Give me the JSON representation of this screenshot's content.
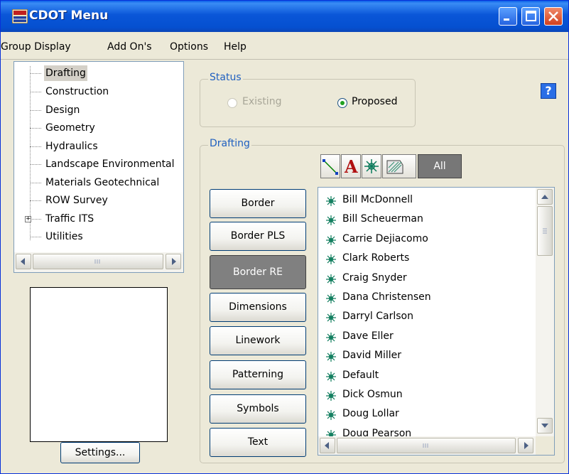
{
  "window": {
    "title": "CDOT Menu",
    "icon": "cdot-app-icon"
  },
  "menubar": [
    "Group Display",
    "Add On's",
    "Options",
    "Help"
  ],
  "tree": {
    "items": [
      "Drafting",
      "Construction",
      "Design",
      "Geometry",
      "Hydraulics",
      "Landscape Environmental",
      "Materials Geotechnical",
      "ROW Survey",
      "Traffic ITS",
      "Utilities"
    ],
    "selected": "Drafting",
    "expandable": "Traffic ITS",
    "expander_glyph": "+"
  },
  "settings_label": "Settings...",
  "status": {
    "title": "Status",
    "existing_label": "Existing",
    "proposed_label": "Proposed",
    "selected": "Proposed"
  },
  "help_label": "?",
  "drafting": {
    "title": "Drafting",
    "filters": {
      "line_icon": "line-tool-icon",
      "text_glyph": "A",
      "cell_icon": "cell-icon",
      "pattern_icon": "pattern-icon",
      "all_label": "All"
    },
    "categories": [
      "Border",
      "Border PLS",
      "Border RE",
      "Dimensions",
      "Linework",
      "Patterning",
      "Symbols",
      "Text"
    ],
    "active_category": "Border RE",
    "list": [
      "Bill McDonnell",
      "Bill Scheuerman",
      "Carrie Dejiacomo",
      "Clark Roberts",
      "Craig Snyder",
      "Dana Christensen",
      "Darryl Carlson",
      "Dave Eller",
      "David Miller",
      "Default",
      "Dick Osmun",
      "Doug Lollar",
      "Doug Pearson"
    ]
  },
  "colors": {
    "title_bar": "#0a56d8",
    "window_bg": "#ece9d8",
    "group_title": "#2060c0",
    "pressed_button": "#808080",
    "cell_icon": "#0a7a5a"
  }
}
